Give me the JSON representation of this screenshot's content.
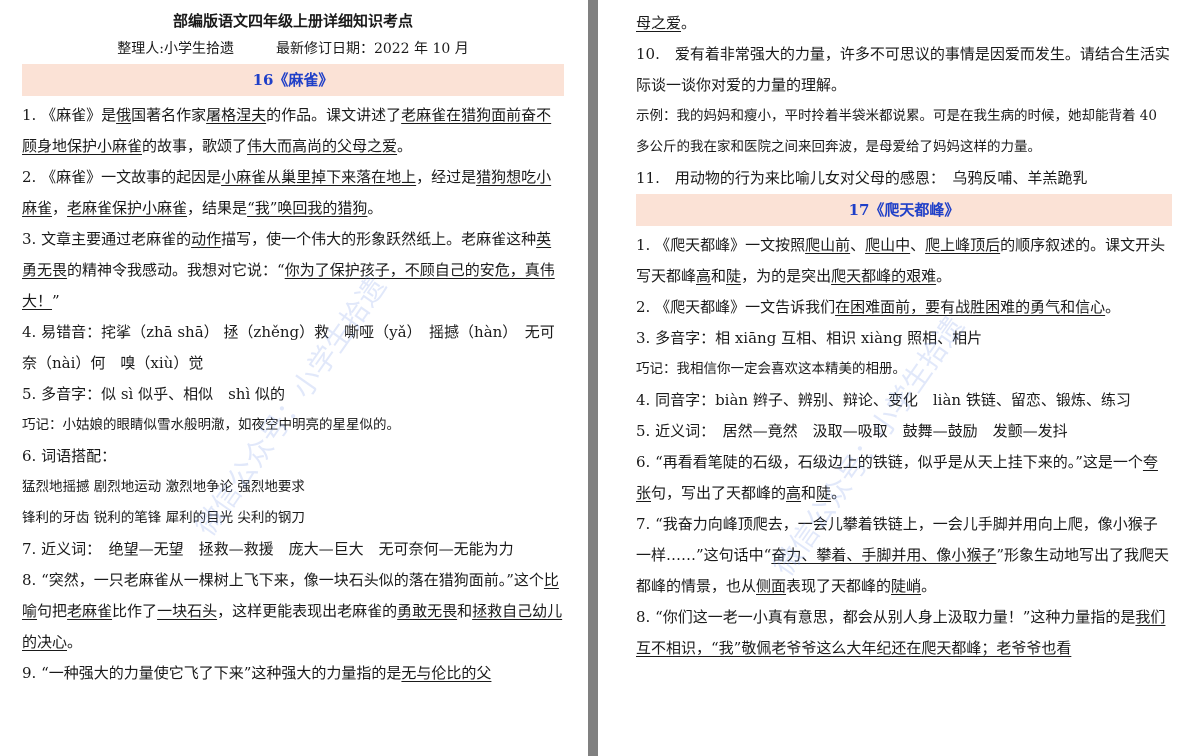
{
  "left": {
    "title": "部编版语文四年级上册详细知识考点",
    "meta": "整理人:小学生拾遗　　　最新修订日期：2022 年 10 月",
    "section16": "16《麻雀》",
    "p1a": "1. 《麻雀》是",
    "p1b": "俄",
    "p1c": "国著名作家",
    "p1d": "屠格涅夫",
    "p1e": "的作品。课文讲述了",
    "p1f": "老麻雀在猎狗面前奋不顾身地保护小麻雀",
    "p1g": "的故事，歌颂了",
    "p1h": "伟大而高尚的父母之爱",
    "p1i": "。",
    "p2a": "2. 《麻雀》一文故事的起因是",
    "p2b": "小麻雀从巢里掉下来落在地上",
    "p2c": "，经过是",
    "p2d": "猎狗想吃小麻雀",
    "p2e": "，",
    "p2f": "老麻雀保护小麻雀",
    "p2g": "，结果是",
    "p2h": "“我”唤回我的猎狗",
    "p2i": "。",
    "p3a": "3. 文章主要通过老麻雀的",
    "p3b": "动作",
    "p3c": "描写，使一个伟大的形象跃然纸上。老麻雀这种",
    "p3d": "英勇无畏",
    "p3e": "的精神令我感动。我想对它说：“",
    "p3f": "你为了保护孩子，不顾自己的安危，真伟大！",
    "p3g": "”",
    "p4": "4. 易错音：挓挲（zhā shā） 拯（zhěng）救　嘶哑（yǎ）　摇撼（hàn）　无可奈（nài）何　嗅（xiù）觉",
    "p5": "5. 多音字：似 sì 似乎、相似　shì 似的",
    "p5note": "巧记：小姑娘的眼睛似雪水般明澈，如夜空中明亮的星星似的。",
    "p6": "6. 词语搭配：",
    "p6a": "猛烈地摇撼 剧烈地运动 激烈地争论 强烈地要求",
    "p6b": "锋利的牙齿 锐利的笔锋 犀利的目光 尖利的钢刀",
    "p7": "7. 近义词：　绝望—无望　拯救—救援　庞大—巨大　无可奈何—无能为力",
    "p8a": "8. “突然，一只老麻雀从一棵树上飞下来，像一块石头似的落在猎狗面前。”这个",
    "p8b": "比喻",
    "p8c": "句把",
    "p8d": "老麻雀",
    "p8e": "比作了",
    "p8f": "一块石头",
    "p8g": "，这样更能表现出老麻雀的",
    "p8h": "勇敢无畏",
    "p8i": "和",
    "p8j": "拯救自己幼儿的决心",
    "p8k": "。",
    "p9a": "9. “一种强大的力量使它飞了下来”这种强大的力量指的是",
    "p9b": "无与伦比的父"
  },
  "right": {
    "cont": "母之爱",
    "cont2": "。",
    "p10": "10.　爱有着非常强大的力量，许多不可思议的事情是因爱而发生。请结合生活实际谈一谈你对爱的力量的理解。",
    "p10note": "示例：我的妈妈和瘦小，平时拎着半袋米都说累。可是在我生病的时候，她却能背着 40 多公斤的我在家和医院之间来回奔波，是母爱给了妈妈这样的力量。",
    "p11": "11.　用动物的行为来比喻儿女对父母的感恩：　乌鸦反哺、羊羔跪乳",
    "section17": "17《爬天都峰》",
    "q1a": "1. 《爬天都峰》一文按照",
    "q1b": "爬山前",
    "q1c": "、",
    "q1d": "爬山中",
    "q1e": "、",
    "q1f": "爬上峰顶后",
    "q1g": "的顺序叙述的。课文开头写天都峰",
    "q1h": "高",
    "q1i": "和",
    "q1j": "陡",
    "q1k": "，为的是突出",
    "q1l": "爬天都峰的艰难",
    "q1m": "。",
    "q2a": "2. 《爬天都峰》一文告诉我们",
    "q2b": "在困难面前，要有战胜困难的勇气和信心",
    "q2c": "。",
    "q3": "3. 多音字：相 xiāng 互相、相识 xiàng 照相、相片",
    "q3note": "巧记：我相信你一定会喜欢这本精美的相册。",
    "q4": "4. 同音字：biàn 辫子、辨别、辩论、变化　liàn 铁链、留恋、锻炼、练习",
    "q5": "5. 近义词：　居然—竟然　汲取—吸取　鼓舞—鼓励　发颤—发抖",
    "q6a": "6. “再看看笔陡的石级，石级边上的铁链，似乎是从天上挂下来的。”这是一个",
    "q6b": "夸张",
    "q6c": "句，写出了天都峰的",
    "q6d": "高",
    "q6e": "和",
    "q6f": "陡",
    "q6g": "。",
    "q7a": "7. “我奋力向峰顶爬去，一会儿攀着铁链上，一会儿手脚并用向上爬，像小猴子一样……”这句话中“",
    "q7b": "奋力、攀着、手脚并用、像小猴子",
    "q7c": "”形象生动地写出了我爬天都峰的情景，也从",
    "q7d": "侧面",
    "q7e": "表现了天都峰的",
    "q7f": "陡峭",
    "q7g": "。",
    "q8a": "8. “你们这一老一小真有意思，都会从别人身上汲取力量！”这种力量指的是",
    "q8b": "我们互不相识，“我”敬佩老爷爷这么大年纪还在爬天都峰；老爷爷也看"
  },
  "watermark": {
    "left": "微信公众号：小学生拾遗",
    "right": "微信公众号：小学生拾遗"
  },
  "colors": {
    "header_bg": "#fbe2d6",
    "header_text": "#1f3fc8",
    "watermark": "#7896e6"
  }
}
